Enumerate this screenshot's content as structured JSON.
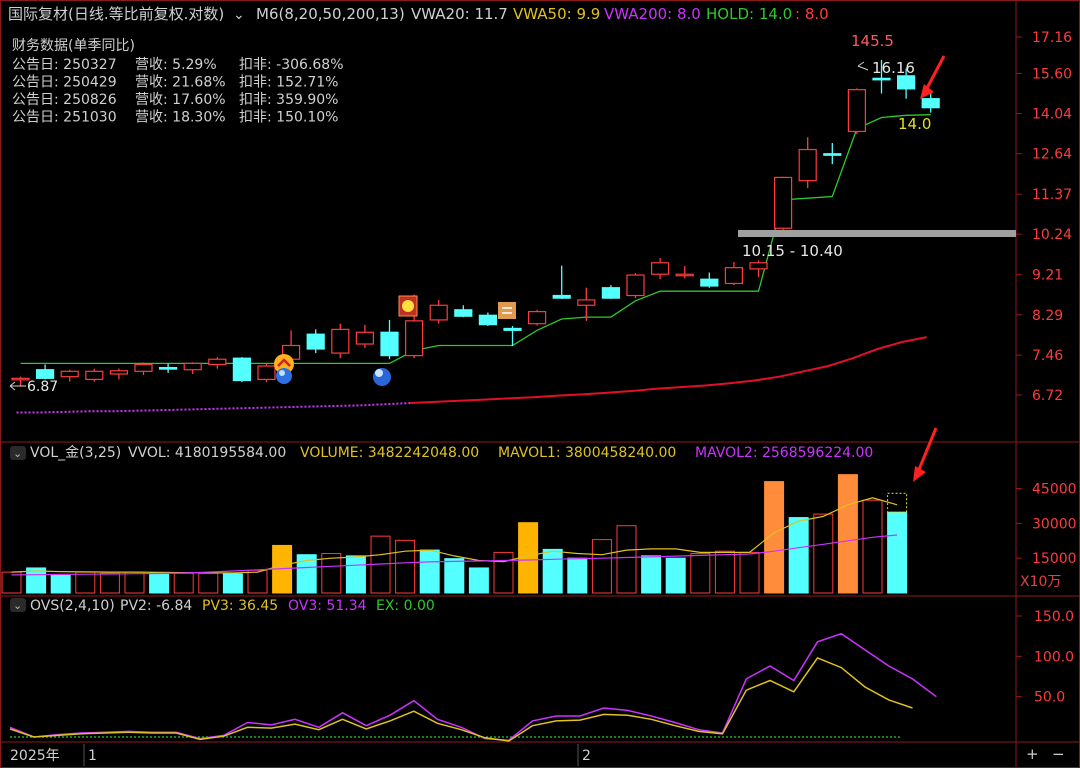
{
  "header": {
    "title": "国际复材(日线.等比前复权.对数)",
    "ma_label": "M6(8,20,50,200,13)",
    "vwa20": "VWA20: 11.7",
    "vwa50": "VWA50: 9.9",
    "vwa200": "VWA200: 8.0",
    "hold": "HOLD: 14.0",
    "hold_val": ": 8.0"
  },
  "financials": {
    "title": "财务数据(单季同比)",
    "rows": [
      {
        "date": "公告日: 250327",
        "revenue": "营收:  5.29%",
        "profit": "扣非:  -306.68%"
      },
      {
        "date": "公告日: 250429",
        "revenue": "营收:  21.68%",
        "profit": "扣非:  152.71%"
      },
      {
        "date": "公告日: 250826",
        "revenue": "营收:  17.60%",
        "profit": "扣非:  359.90%"
      },
      {
        "date": "公告日: 251030",
        "revenue": "营收:  18.30%",
        "profit": "扣非:  150.10%"
      }
    ]
  },
  "annotations": {
    "high": "145.5",
    "high_price": "16.16",
    "last": "14.0",
    "range": "10.15 - 10.40",
    "low": "6.87"
  },
  "vol_header": {
    "name": "VOL_金(3,25)",
    "vvol": "VVOL: 4180195584.00",
    "volume": "VOLUME: 3482242048.00",
    "mavol1": "MAVOL1: 3800458240.00",
    "mavol2": "MAVOL2: 2568596224.00",
    "unit": "X10万"
  },
  "ovs_header": {
    "name": "OVS(2,4,10)",
    "pv2": "PV2: -6.84",
    "pv3": "PV3: 36.45",
    "ov3": "OV3: 51.34",
    "ex": "EX: 0.00"
  },
  "xaxis": {
    "year": "2025年",
    "m1": "1",
    "m2": "2",
    "plus": "+",
    "minus": "−"
  },
  "colors": {
    "up": "#ff3b3b",
    "down": "#54ffff",
    "orange": "#ff8c3a",
    "gold": "#ffb400",
    "ma_green": "#2ec82e",
    "ma_red": "#e0102a",
    "purple": "#cc33ff",
    "yellow": "#e0c21e"
  },
  "chart_data": {
    "price": {
      "type": "candlestick",
      "scale": "log",
      "y_ticks": [
        17.16,
        15.6,
        14.04,
        12.64,
        11.37,
        10.24,
        9.21,
        8.29,
        7.46,
        6.72
      ],
      "candles": [
        {
          "o": 7.0,
          "h": 7.05,
          "l": 6.87,
          "c": 7.02
        },
        {
          "o": 7.18,
          "h": 7.28,
          "l": 7.0,
          "c": 7.02
        },
        {
          "o": 7.05,
          "h": 7.18,
          "l": 6.96,
          "c": 7.15
        },
        {
          "o": 7.0,
          "h": 7.2,
          "l": 6.96,
          "c": 7.15
        },
        {
          "o": 7.1,
          "h": 7.2,
          "l": 7.0,
          "c": 7.16
        },
        {
          "o": 7.15,
          "h": 7.32,
          "l": 7.08,
          "c": 7.28
        },
        {
          "o": 7.22,
          "h": 7.3,
          "l": 7.12,
          "c": 7.2
        },
        {
          "o": 7.18,
          "h": 7.32,
          "l": 7.1,
          "c": 7.3
        },
        {
          "o": 7.28,
          "h": 7.42,
          "l": 7.2,
          "c": 7.38
        },
        {
          "o": 7.4,
          "h": 7.42,
          "l": 6.95,
          "c": 6.98
        },
        {
          "o": 7.0,
          "h": 7.3,
          "l": 6.95,
          "c": 7.25
        },
        {
          "o": 7.38,
          "h": 7.96,
          "l": 7.3,
          "c": 7.65
        },
        {
          "o": 7.88,
          "h": 7.98,
          "l": 7.5,
          "c": 7.58
        },
        {
          "o": 7.5,
          "h": 8.1,
          "l": 7.4,
          "c": 7.98
        },
        {
          "o": 7.68,
          "h": 8.08,
          "l": 7.6,
          "c": 7.92
        },
        {
          "o": 7.92,
          "h": 8.18,
          "l": 7.38,
          "c": 7.45
        },
        {
          "o": 7.45,
          "h": 8.74,
          "l": 7.4,
          "c": 8.16
        },
        {
          "o": 8.18,
          "h": 8.62,
          "l": 8.1,
          "c": 8.5
        },
        {
          "o": 8.4,
          "h": 8.5,
          "l": 8.24,
          "c": 8.26
        },
        {
          "o": 8.28,
          "h": 8.34,
          "l": 8.05,
          "c": 8.08
        },
        {
          "o": 8.0,
          "h": 8.05,
          "l": 7.64,
          "c": 7.96
        },
        {
          "o": 8.1,
          "h": 8.4,
          "l": 8.06,
          "c": 8.36
        },
        {
          "o": 8.72,
          "h": 9.43,
          "l": 8.64,
          "c": 8.66
        },
        {
          "o": 8.5,
          "h": 8.9,
          "l": 8.16,
          "c": 8.62
        },
        {
          "o": 8.9,
          "h": 8.96,
          "l": 8.64,
          "c": 8.66
        },
        {
          "o": 8.72,
          "h": 9.25,
          "l": 8.66,
          "c": 9.2
        },
        {
          "o": 9.22,
          "h": 9.62,
          "l": 9.1,
          "c": 9.5
        },
        {
          "o": 9.2,
          "h": 9.42,
          "l": 9.12,
          "c": 9.22
        },
        {
          "o": 9.1,
          "h": 9.26,
          "l": 8.9,
          "c": 8.94
        },
        {
          "o": 9.0,
          "h": 9.52,
          "l": 8.96,
          "c": 9.38
        },
        {
          "o": 9.35,
          "h": 9.56,
          "l": 9.15,
          "c": 9.5
        },
        {
          "o": 10.4,
          "h": 11.9,
          "l": 10.3,
          "c": 11.88
        },
        {
          "o": 11.78,
          "h": 13.2,
          "l": 11.55,
          "c": 12.78
        },
        {
          "o": 12.64,
          "h": 13.0,
          "l": 12.3,
          "c": 12.62
        },
        {
          "o": 13.4,
          "h": 15.0,
          "l": 13.3,
          "c": 14.95
        },
        {
          "o": 15.4,
          "h": 16.16,
          "l": 14.8,
          "c": 15.34
        },
        {
          "o": 15.5,
          "h": 15.8,
          "l": 14.6,
          "c": 14.98
        },
        {
          "o": 14.6,
          "h": 14.8,
          "l": 14.08,
          "c": 14.26
        }
      ],
      "hold_line": [
        7.3,
        7.3,
        7.3,
        7.3,
        7.3,
        7.3,
        7.3,
        7.3,
        7.3,
        7.3,
        7.3,
        7.3,
        7.3,
        7.3,
        7.3,
        7.3,
        7.55,
        7.65,
        7.65,
        7.65,
        7.65,
        7.96,
        8.2,
        8.24,
        8.24,
        8.6,
        8.82,
        8.82,
        8.82,
        8.82,
        8.82,
        11.2,
        11.25,
        11.3,
        13.5,
        13.9,
        13.98,
        14.0
      ],
      "vwa200_line": [
        6.42,
        6.42,
        6.43,
        6.44,
        6.44,
        6.45,
        6.46,
        6.47,
        6.48,
        6.49,
        6.5,
        6.51,
        6.52,
        6.53,
        6.54,
        6.56,
        6.58,
        6.6,
        6.62,
        6.64,
        6.66,
        6.68,
        6.71,
        6.73,
        6.76,
        6.79,
        6.83,
        6.86,
        6.89,
        6.93,
        6.98,
        7.05,
        7.15,
        7.25,
        7.4,
        7.58,
        7.72,
        7.82
      ]
    },
    "volume": {
      "type": "bar",
      "unit": "X10万",
      "y_ticks": [
        45000,
        30000,
        15000
      ],
      "values": [
        9000,
        10800,
        7600,
        9000,
        8500,
        9000,
        8800,
        8500,
        8500,
        8200,
        9800,
        20500,
        16500,
        17000,
        16000,
        24500,
        22700,
        18500,
        14800,
        10800,
        17500,
        30300,
        18800,
        15000,
        23000,
        29000,
        16000,
        15000,
        17000,
        18000,
        17500,
        48000,
        32500,
        34000,
        51000,
        40000,
        34818
      ],
      "styles": [
        "up",
        "down",
        "down",
        "up",
        "up",
        "up",
        "down",
        "up",
        "up",
        "down",
        "up",
        "gold",
        "down",
        "up",
        "down",
        "up",
        "up",
        "down",
        "down",
        "down",
        "up",
        "gold",
        "down",
        "down",
        "up",
        "up",
        "down",
        "down",
        "up",
        "up",
        "up",
        "orange",
        "down",
        "up",
        "orange",
        "up",
        "down"
      ],
      "mavol1": [
        9000,
        9500,
        9200,
        9100,
        9000,
        9000,
        8900,
        8800,
        8700,
        8600,
        9000,
        12000,
        14000,
        15000,
        15500,
        16500,
        18000,
        18500,
        16000,
        14000,
        13500,
        16000,
        18000,
        17000,
        16500,
        18500,
        19000,
        19000,
        17500,
        17500,
        17500,
        26000,
        31000,
        33000,
        38000,
        41000,
        38000
      ],
      "mavol2": [
        7800,
        7900,
        8000,
        8100,
        8200,
        8300,
        8400,
        8600,
        9000,
        9500,
        10000,
        10500,
        11000,
        11500,
        12000,
        12500,
        13000,
        13400,
        13600,
        13800,
        14000,
        14200,
        14500,
        14800,
        15000,
        15300,
        15600,
        15900,
        16200,
        16500,
        16800,
        18000,
        19500,
        21000,
        22500,
        24000,
        25000
      ]
    },
    "ovs": {
      "type": "line",
      "y_ticks": [
        150.0,
        100.0,
        50.0
      ],
      "ov3": [
        12,
        0,
        3,
        5,
        6,
        7,
        6,
        6,
        -2,
        2,
        18,
        15,
        22,
        12,
        30,
        14,
        27,
        45,
        22,
        12,
        -2,
        -4,
        20,
        26,
        26,
        36,
        33,
        26,
        18,
        9,
        5,
        72,
        88,
        70,
        118,
        128,
        108,
        88,
        72,
        50
      ],
      "pv3": [
        10,
        0,
        2,
        4,
        5,
        6,
        5,
        5,
        -3,
        1,
        12,
        11,
        16,
        9,
        22,
        10,
        20,
        32,
        17,
        9,
        -1,
        -5,
        14,
        20,
        21,
        28,
        27,
        22,
        14,
        7,
        4,
        58,
        70,
        56,
        98,
        86,
        62,
        46,
        36
      ],
      "ex": 0
    }
  }
}
